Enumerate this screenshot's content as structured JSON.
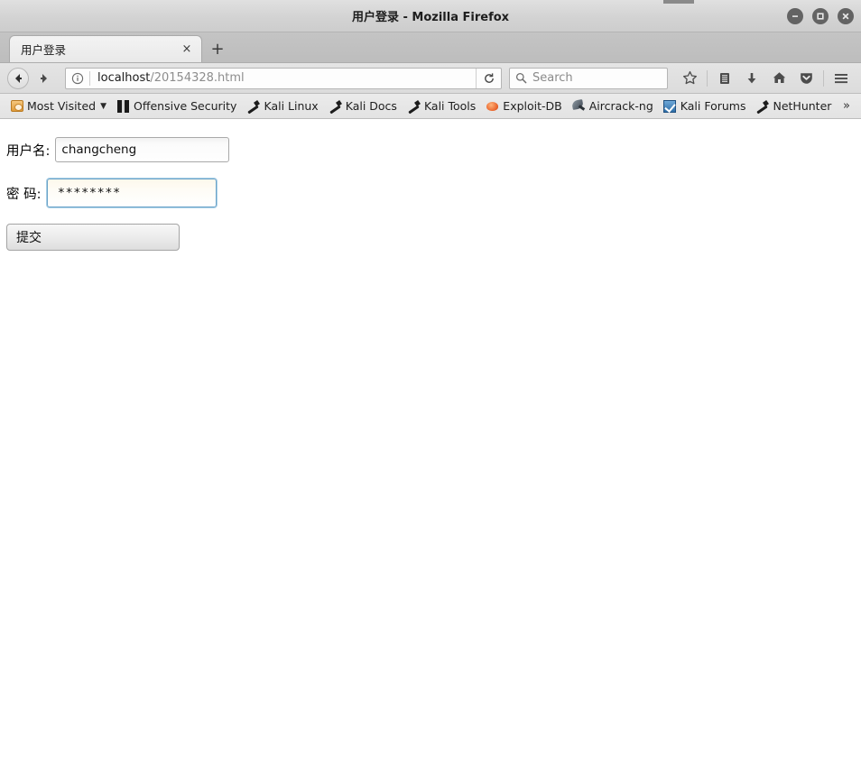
{
  "window": {
    "title": "用户登录 - Mozilla Firefox",
    "controls": [
      {
        "name": "minimize",
        "glyph": "−"
      },
      {
        "name": "maximize",
        "glyph": "□"
      },
      {
        "name": "close",
        "glyph": "×"
      }
    ]
  },
  "tabs": {
    "items": [
      {
        "label": "用户登录",
        "close_label": "×",
        "active": true
      }
    ],
    "new_tab_label": "+"
  },
  "toolbar": {
    "back_label": "◀",
    "forward_label": "▶",
    "identity_icon": "info-icon",
    "url": {
      "host": "localhost",
      "path": "/20154328.html",
      "full": "localhost/20154328.html"
    },
    "reload_label": "⟳",
    "search": {
      "placeholder": "Search",
      "value": ""
    },
    "icons": [
      {
        "name": "bookmark-star-icon",
        "label": "Bookmark"
      },
      {
        "name": "library-icon",
        "label": "Library"
      },
      {
        "name": "download-icon",
        "label": "Downloads"
      },
      {
        "name": "home-icon",
        "label": "Home"
      },
      {
        "name": "pocket-icon",
        "label": "Pocket"
      },
      {
        "name": "menu-icon",
        "label": "Open menu"
      }
    ]
  },
  "bookmarks": {
    "items": [
      {
        "label": "Most Visited",
        "icon": "most-visited-icon",
        "has_chevron": true
      },
      {
        "label": "Offensive Security",
        "icon": "offensive-security-icon",
        "has_chevron": false
      },
      {
        "label": "Kali Linux",
        "icon": "kali-dragon-icon",
        "has_chevron": false
      },
      {
        "label": "Kali Docs",
        "icon": "kali-dragon-icon",
        "has_chevron": false
      },
      {
        "label": "Kali Tools",
        "icon": "kali-dragon-icon",
        "has_chevron": false
      },
      {
        "label": "Exploit-DB",
        "icon": "exploit-db-icon",
        "has_chevron": false
      },
      {
        "label": "Aircrack-ng",
        "icon": "aircrack-ng-icon",
        "has_chevron": false
      },
      {
        "label": "Kali Forums",
        "icon": "kali-forums-icon",
        "has_chevron": false
      },
      {
        "label": "NetHunter",
        "icon": "kali-dragon-icon",
        "has_chevron": false
      }
    ],
    "overflow_label": "»"
  },
  "page": {
    "username": {
      "label": "用户名:",
      "value": "changcheng",
      "placeholder": ""
    },
    "password": {
      "label": "密 码:",
      "value": "********",
      "placeholder": "",
      "focused": true
    },
    "submit": {
      "label": "提交"
    }
  },
  "colors": {
    "titlebar": "#d5d5d5",
    "tabstrip": "#c0c0c0",
    "toolbar": "#e0e0e0",
    "focus_border": "#6ba3c8",
    "page_bg": "#ffffff"
  }
}
